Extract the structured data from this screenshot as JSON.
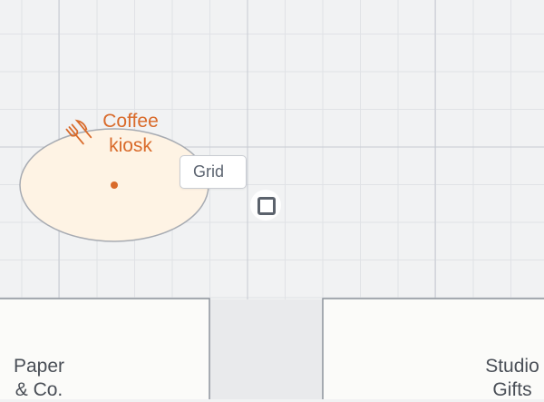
{
  "map": {
    "grid_toggle_label": "Grid",
    "poi": {
      "label": "Coffee\nkiosk",
      "icon": "fork-knife-icon",
      "color": "#d96a2a"
    },
    "stores": [
      {
        "id": "paper",
        "label": "Paper\n& Co."
      },
      {
        "id": "studio",
        "label": "Studio\nGifts"
      }
    ],
    "control": {
      "icon": "square-toggle-icon"
    }
  }
}
